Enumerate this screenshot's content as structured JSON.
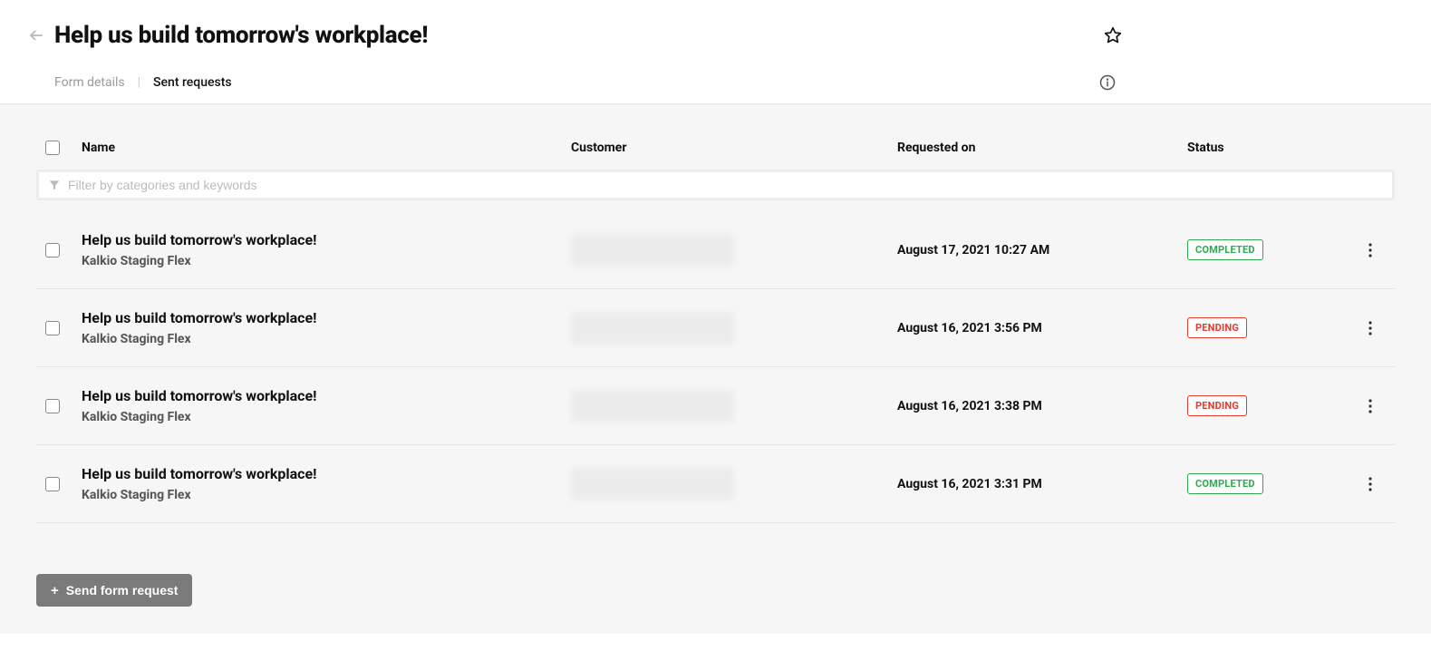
{
  "header": {
    "title": "Help us build tomorrow's workplace!"
  },
  "tabs": {
    "form_details": "Form details",
    "sent_requests": "Sent requests"
  },
  "columns": {
    "name": "Name",
    "customer": "Customer",
    "requested_on": "Requested on",
    "status": "Status"
  },
  "filter": {
    "placeholder": "Filter by categories and keywords"
  },
  "status_labels": {
    "completed": "COMPLETED",
    "pending": "PENDING"
  },
  "rows": [
    {
      "name": "Help us build tomorrow's workplace!",
      "sub": "Kalkio Staging Flex",
      "requested_on": "August 17, 2021 10:27 AM",
      "status": "completed"
    },
    {
      "name": "Help us build tomorrow's workplace!",
      "sub": "Kalkio Staging Flex",
      "requested_on": "August 16, 2021 3:56 PM",
      "status": "pending"
    },
    {
      "name": "Help us build tomorrow's workplace!",
      "sub": "Kalkio Staging Flex",
      "requested_on": "August 16, 2021 3:38 PM",
      "status": "pending"
    },
    {
      "name": "Help us build tomorrow's workplace!",
      "sub": "Kalkio Staging Flex",
      "requested_on": "August 16, 2021 3:31 PM",
      "status": "completed"
    }
  ],
  "footer": {
    "send_label": "Send form request"
  }
}
